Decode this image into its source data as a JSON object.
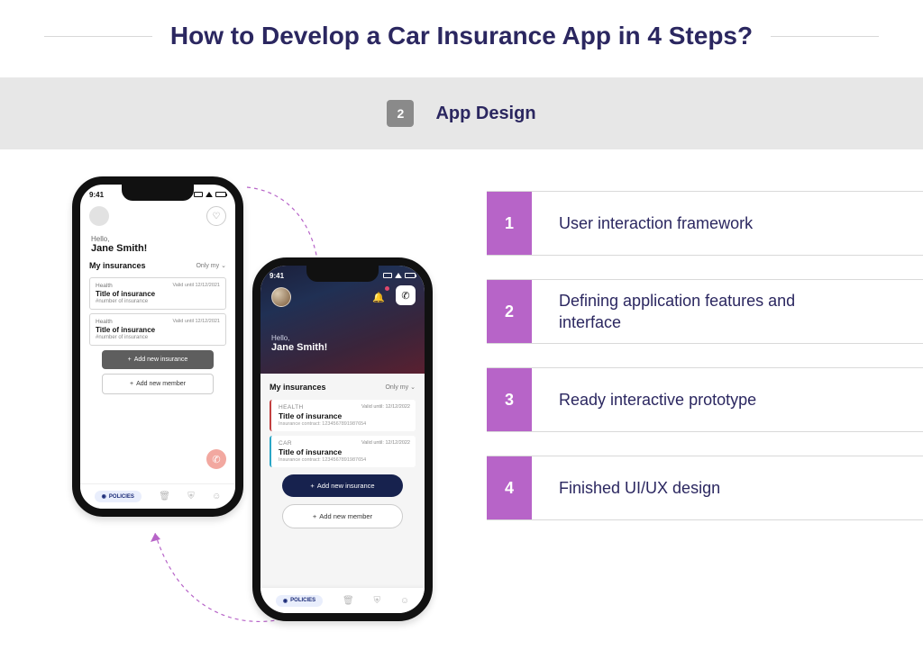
{
  "title": "How to Develop a Car Insurance App in 4 Steps?",
  "band": {
    "number": "2",
    "label": "App Design"
  },
  "steps": [
    {
      "num": "1",
      "text": "User interaction framework"
    },
    {
      "num": "2",
      "text": "Defining application features and interface"
    },
    {
      "num": "3",
      "text": "Ready interactive prototype"
    },
    {
      "num": "4",
      "text": "Finished UI/UX design"
    }
  ],
  "phone_common": {
    "time": "9:41",
    "section_title": "My insurances",
    "filter_label": "Only my",
    "add_insurance": "Add new insurance",
    "add_member": "Add new member",
    "tab_policies": "POLICIES"
  },
  "phone_a": {
    "hello_prefix": "Hello,",
    "hello_name": "Jane Smith!",
    "cards": [
      {
        "tag": "Health",
        "valid": "Valid until 12/12/2021",
        "title": "Title of insurance",
        "sub": "#number of insurance"
      },
      {
        "tag": "Health",
        "valid": "Valid until 12/12/2021",
        "title": "Title of insurance",
        "sub": "#number of insurance"
      }
    ]
  },
  "phone_b": {
    "hello_prefix": "Hello,",
    "hello_name": "Jane Smith!",
    "cards": [
      {
        "tag": "HEALTH",
        "valid": "Valid until: 12/12/2022",
        "title": "Title of insurance",
        "sub": "Insurance contract: 1234567891987654"
      },
      {
        "tag": "CAR",
        "valid": "Valid until: 12/12/2022",
        "title": "Title of insurance",
        "sub": "Insurance contract: 1234567891987654"
      }
    ]
  }
}
